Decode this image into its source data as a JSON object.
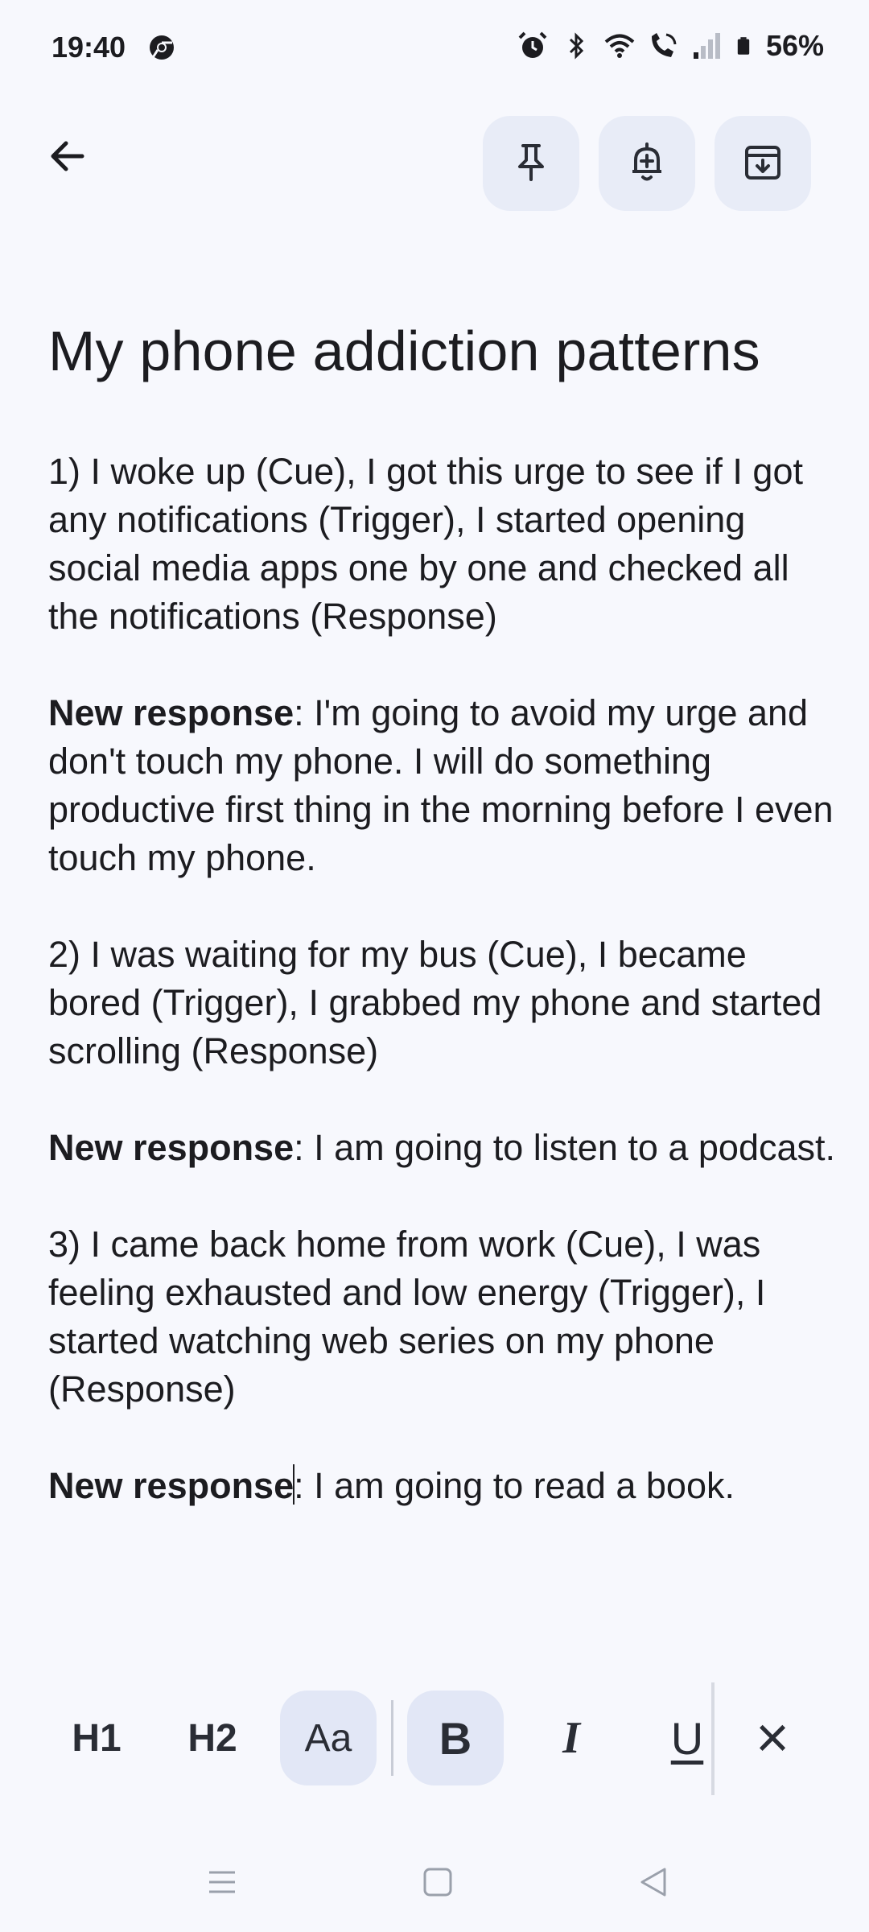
{
  "status_bar": {
    "time": "19:40",
    "battery": "56%",
    "icons": [
      "chrome-icon",
      "alarm-icon",
      "bluetooth-icon",
      "wifi-icon",
      "wifi-calling-icon",
      "signal-icon",
      "battery-icon"
    ]
  },
  "toolbar": {
    "icons": [
      "back-arrow-icon",
      "pin-icon",
      "add-reminder-icon",
      "archive-icon"
    ]
  },
  "note": {
    "title": "My phone addiction patterns",
    "paragraphs": [
      {
        "text": "1) I woke up (Cue), I got this urge to see if I got any notifications (Trigger), I started opening social media apps one by one and checked all the notifications (Response)"
      },
      {
        "bold": "New response",
        "text": ": I'm going to avoid my urge and don't touch my phone. I will do something productive first thing in the morning before I even touch my phone."
      },
      {
        "text": "2) I was waiting for my bus (Cue), I became bored (Trigger), I grabbed my phone and started scrolling (Response)"
      },
      {
        "bold": "New response",
        "text": ": I am going to listen to a podcast."
      },
      {
        "text": "3) I came back home from work (Cue), I was feeling exhausted and low energy (Trigger), I started watching web series on my phone (Response)"
      },
      {
        "bold": "New response",
        "text": ": I am going to read a book."
      }
    ]
  },
  "format_bar": {
    "h1": "H1",
    "h2": "H2",
    "normal_text": "Aa",
    "bold": "B",
    "italic": "I",
    "underline": "U",
    "close": "×"
  },
  "nav_bar": {
    "icons": [
      "recents-icon",
      "home-icon",
      "back-icon"
    ]
  },
  "colors": {
    "background": "#f7f8fd",
    "button_bg": "#e8ecf7",
    "active_bg": "#e2e7f6",
    "text": "#1c1c20"
  }
}
